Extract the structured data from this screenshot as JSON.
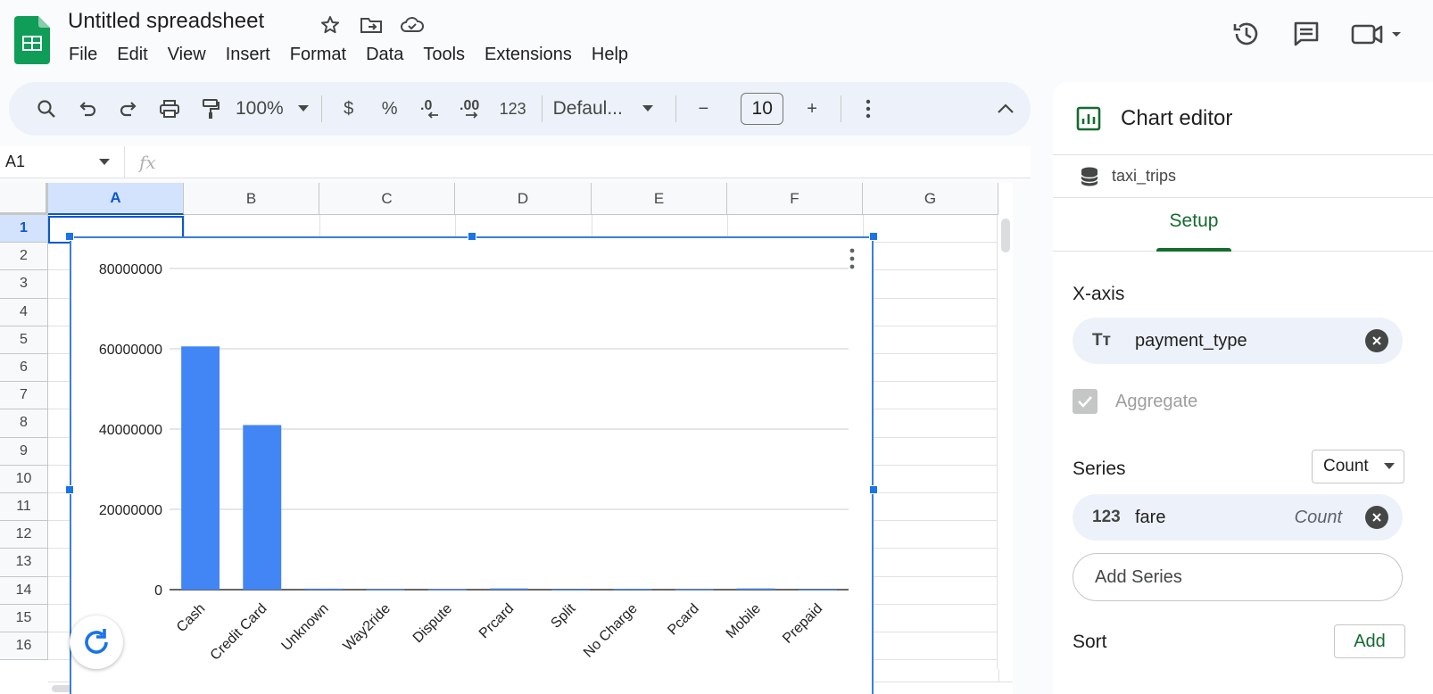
{
  "document": {
    "title": "Untitled spreadsheet"
  },
  "menu": [
    "File",
    "Edit",
    "View",
    "Insert",
    "Format",
    "Data",
    "Tools",
    "Extensions",
    "Help"
  ],
  "toolbar": {
    "zoom": "100%",
    "currency": "$",
    "percent": "%",
    "decrease_decimal": ".0",
    "increase_decimal": ".00",
    "number_format": "123",
    "font": "Defaul...",
    "font_size": "10",
    "minus": "−",
    "plus": "+"
  },
  "formula_bar": {
    "cell_ref": "A1",
    "fx": "fx",
    "value": ""
  },
  "grid": {
    "columns": [
      "A",
      "B",
      "C",
      "D",
      "E",
      "F",
      "G"
    ],
    "rows": [
      "1",
      "2",
      "3",
      "4",
      "5",
      "6",
      "7",
      "8",
      "9",
      "10",
      "11",
      "12",
      "13",
      "14",
      "15",
      "16"
    ],
    "selected_cell": "A1"
  },
  "chart_data": {
    "type": "bar",
    "categories": [
      "Cash",
      "Credit Card",
      "Unknown",
      "Way2ride",
      "Dispute",
      "Prcard",
      "Split",
      "No Charge",
      "Pcard",
      "Mobile",
      "Prepaid"
    ],
    "values": [
      60600000,
      41000000,
      250000,
      50000,
      60000,
      300000,
      20000,
      200000,
      50000,
      300000,
      20000
    ],
    "yticks": [
      "0",
      "20000000",
      "40000000",
      "60000000",
      "80000000"
    ],
    "ylim": [
      0,
      80000000
    ],
    "title": "",
    "xlabel": "",
    "ylabel": "",
    "bar_color": "#4285f4",
    "grid": true
  },
  "panel": {
    "title": "Chart editor",
    "data_source": "taxi_trips",
    "tab": "Setup",
    "xaxis_label": "X-axis",
    "xaxis_field": "payment_type",
    "xaxis_icon": "Tт",
    "aggregate_label": "Aggregate",
    "series_label": "Series",
    "series_agg_dropdown": "Count",
    "series_field": "fare",
    "series_icon": "123",
    "series_agg": "Count",
    "add_series": "Add Series",
    "sort_label": "Sort",
    "sort_add": "Add"
  },
  "colors": {
    "accent_green": "#146c2e",
    "selection_blue": "#0b57d0",
    "bar_blue": "#4285f4"
  }
}
